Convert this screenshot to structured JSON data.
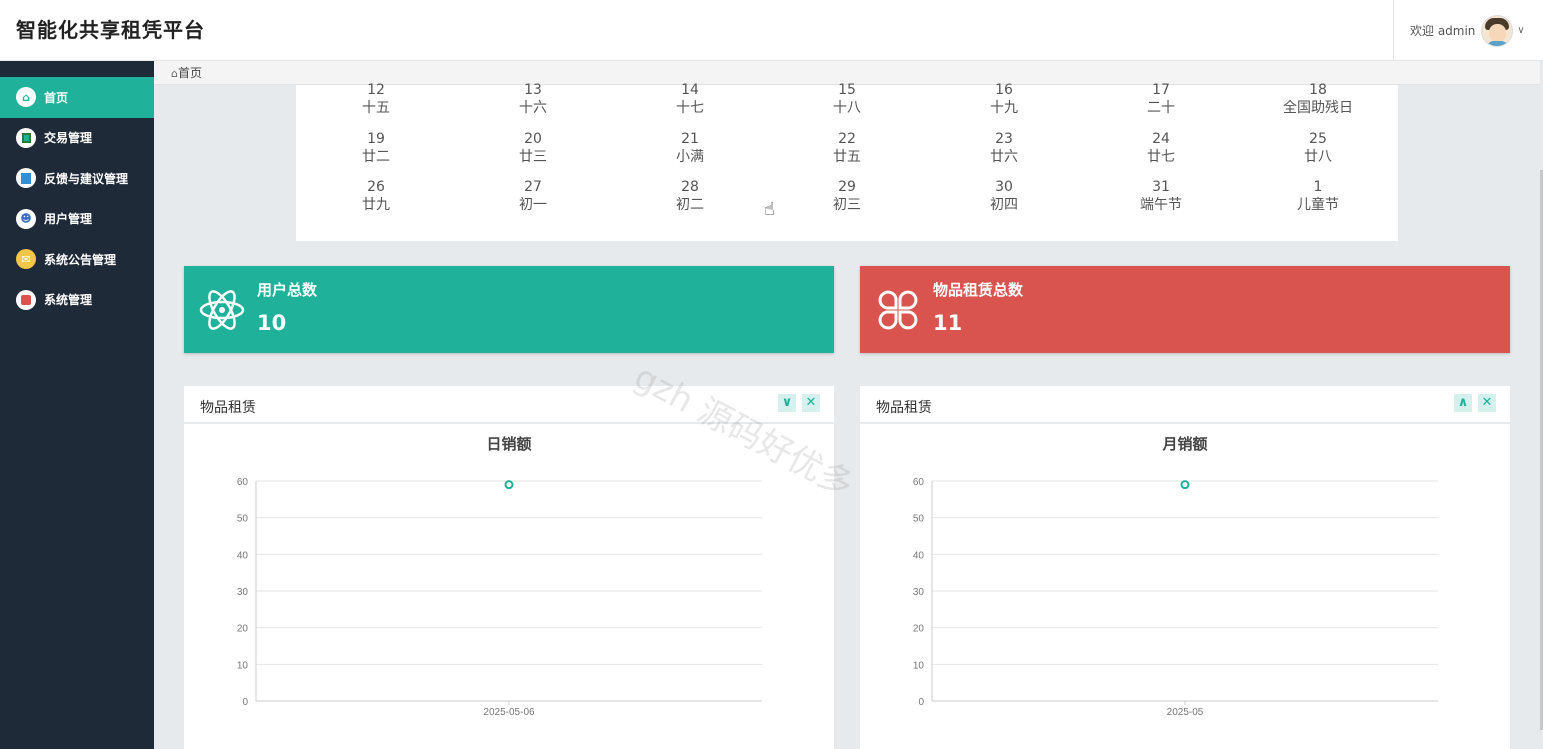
{
  "app": {
    "title": "智能化共享租凭平台"
  },
  "user": {
    "welcome": "欢迎 admin"
  },
  "sidebar": {
    "items": [
      {
        "label": "首页",
        "icon": "home-icon",
        "active": true
      },
      {
        "label": "交易管理",
        "icon": "book-icon"
      },
      {
        "label": "反馈与建议管理",
        "icon": "document-icon"
      },
      {
        "label": "用户管理",
        "icon": "user-icon"
      },
      {
        "label": "系统公告管理",
        "icon": "mail-icon"
      },
      {
        "label": "系统管理",
        "icon": "folder-icon"
      }
    ]
  },
  "breadcrumb": {
    "label": "首页"
  },
  "calendar": {
    "rows": [
      [
        {
          "day": "12",
          "lunar": "十五"
        },
        {
          "day": "13",
          "lunar": "十六"
        },
        {
          "day": "14",
          "lunar": "十七"
        },
        {
          "day": "15",
          "lunar": "十八"
        },
        {
          "day": "16",
          "lunar": "十九"
        },
        {
          "day": "17",
          "lunar": "二十"
        },
        {
          "day": "18",
          "lunar": "全国助残日"
        }
      ],
      [
        {
          "day": "19",
          "lunar": "廿二"
        },
        {
          "day": "20",
          "lunar": "廿三"
        },
        {
          "day": "21",
          "lunar": "小满"
        },
        {
          "day": "22",
          "lunar": "廿五"
        },
        {
          "day": "23",
          "lunar": "廿六"
        },
        {
          "day": "24",
          "lunar": "廿七"
        },
        {
          "day": "25",
          "lunar": "廿八"
        }
      ],
      [
        {
          "day": "26",
          "lunar": "廿九"
        },
        {
          "day": "27",
          "lunar": "初一"
        },
        {
          "day": "28",
          "lunar": "初二"
        },
        {
          "day": "29",
          "lunar": "初三"
        },
        {
          "day": "30",
          "lunar": "初四"
        },
        {
          "day": "31",
          "lunar": "端午节"
        },
        {
          "day": "1",
          "lunar": "儿童节"
        }
      ]
    ]
  },
  "stats": {
    "users": {
      "title": "用户总数",
      "value": "10",
      "icon": "atom-icon",
      "color": "#1fb19a"
    },
    "items": {
      "title": "物品租赁总数",
      "value": "11",
      "icon": "clover-icon",
      "color": "#d9534f"
    }
  },
  "panels": {
    "left": {
      "title": "物品租赁"
    },
    "right": {
      "title": "物品租赁"
    }
  },
  "chart_data": [
    {
      "type": "line",
      "title": "日销额",
      "categories": [
        "2025-05-06"
      ],
      "series": [
        {
          "values": [
            59
          ]
        }
      ],
      "ylim": [
        0,
        60
      ],
      "yticks": [
        0,
        10,
        20,
        30,
        40,
        50,
        60
      ],
      "grid": true,
      "color": "#1fb19a"
    },
    {
      "type": "line",
      "title": "月销额",
      "categories": [
        "2025-05"
      ],
      "series": [
        {
          "values": [
            59
          ]
        }
      ],
      "ylim": [
        0,
        60
      ],
      "yticks": [
        0,
        10,
        20,
        30,
        40,
        50,
        60
      ],
      "grid": true,
      "color": "#1fb19a"
    }
  ],
  "watermark": "gzh 源码好优多"
}
